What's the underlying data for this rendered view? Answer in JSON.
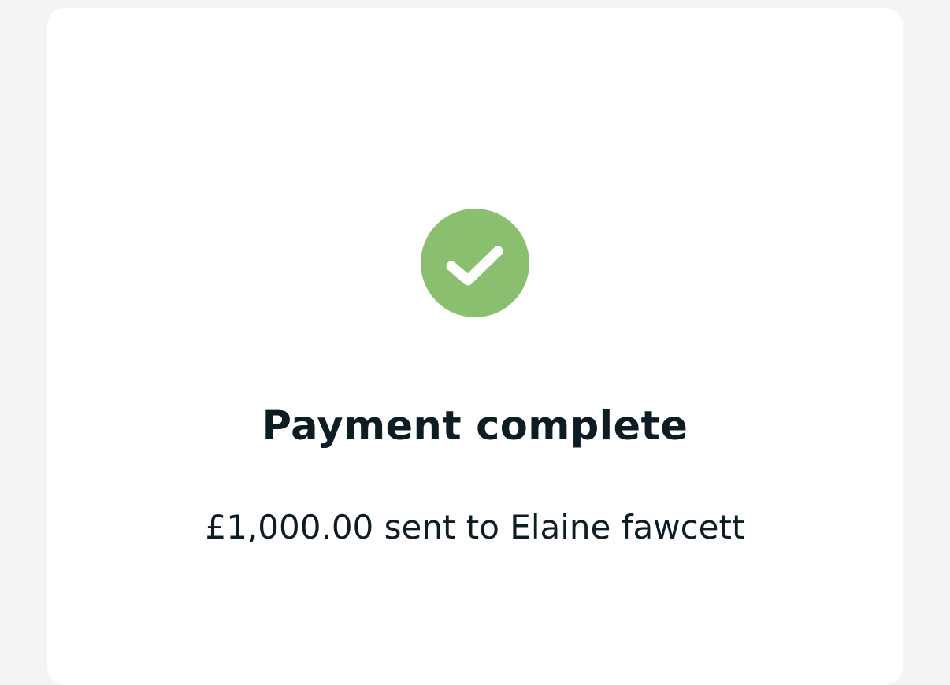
{
  "colors": {
    "page_background": "#f5f4f2",
    "card_background": "#ffffff",
    "success_green": "#89bf6f",
    "checkmark": "#ffffff",
    "text_primary": "#0e1d24"
  },
  "status": {
    "icon": "check-circle-icon"
  },
  "confirmation": {
    "title": "Payment complete",
    "message": "£1,000.00 sent to Elaine fawcett"
  }
}
